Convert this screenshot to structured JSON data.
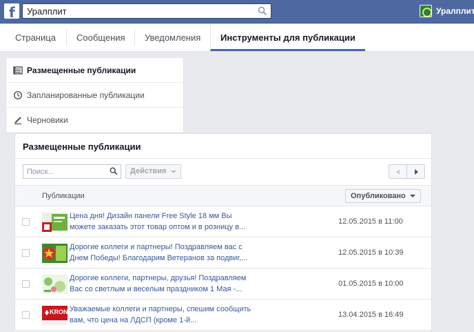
{
  "topbar": {
    "logo_icon": "facebook-f-icon",
    "search_value": "Уралплит",
    "profile_name": "Уралплит"
  },
  "tabs": [
    {
      "label": "Страница"
    },
    {
      "label": "Сообщения"
    },
    {
      "label": "Уведомления"
    },
    {
      "label": "Инструменты для публикации",
      "active": true
    }
  ],
  "sidebar": {
    "items": [
      {
        "label": "Размещенные публикации",
        "icon": "list-icon",
        "active": true
      },
      {
        "label": "Запланированные публикации",
        "icon": "clock-icon"
      },
      {
        "label": "Черновики",
        "icon": "pencil-icon"
      }
    ]
  },
  "panel": {
    "title": "Размещенные публикации",
    "search_placeholder": "Поиск...",
    "actions_label": "Действия",
    "column_header": "Публикации",
    "status_filter": "Опубликовано",
    "rows": [
      {
        "text": "Цена дня! Дизайн панели Free Style 18 мм Вы можете заказать этот товар оптом и в розницу в...",
        "date": "12.05.2015 в 11:00"
      },
      {
        "text": "Дорогие коллеги и партнеры! Поздравляем вас с Днем Победы! Благодарим Ветеранов за подвиг,...",
        "date": "12.05.2015 в 10:39"
      },
      {
        "text": "Дорогие коллеги, партнеры, друзья! Поздравляем Вас со светлым и веселым праздником 1 Мая -...",
        "date": "01.05.2015 в 10:00"
      },
      {
        "text": "Уважаемые коллеги и партнеры, спешим сообщить вам, что цена на ЛДСП (кроме 1-й...",
        "date": "13.04.2015 в 16:49",
        "thumb_text": "KRONO"
      }
    ]
  },
  "colors": {
    "topbar": "#4e69a2",
    "link": "#365899",
    "tab_active_border": "#4267b2"
  }
}
